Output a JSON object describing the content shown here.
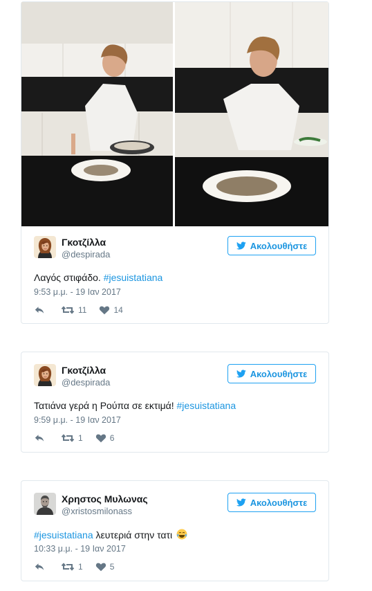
{
  "tweets": [
    {
      "user": "Γκοτζίλλα",
      "handle": "@despirada",
      "follow_label": "Ακολουθήστε",
      "text_before": "Λαγός στιφάδο. ",
      "hashtag": "#jesuistatiana",
      "text_after": "",
      "time": "9:53 μ.μ. - 19 Ιαν 2017",
      "retweets": "11",
      "likes": "14",
      "avatar": "woman-avatar"
    },
    {
      "user": "Γκοτζίλλα",
      "handle": "@despirada",
      "follow_label": "Ακολουθήστε",
      "text_before": "Τατιάνα γερά η Ρούπα σε εκτιμά! ",
      "hashtag": "#jesuistatiana",
      "text_after": "",
      "time": "9:59 μ.μ. - 19 Ιαν 2017",
      "retweets": "1",
      "likes": "6",
      "avatar": "woman-avatar"
    },
    {
      "user": "Χρηστος Μυλωνας",
      "handle": "@xristosmilonass",
      "follow_label": "Ακολουθήστε",
      "text_before": "",
      "hashtag": "#jesuistatiana",
      "text_after": " λευτεριά στην τατι ",
      "emoji": "tears-of-joy-emoji",
      "time": "10:33 μ.μ. - 19 Ιαν 2017",
      "retweets": "1",
      "likes": "5",
      "avatar": "man-avatar"
    }
  ],
  "colors": {
    "accent": "#1da1f2",
    "link": "#1b95e0",
    "muted": "#657786",
    "border": "#e1e8ed"
  },
  "icons": [
    "twitter-bird-icon",
    "reply-icon",
    "retweet-icon",
    "heart-icon"
  ]
}
